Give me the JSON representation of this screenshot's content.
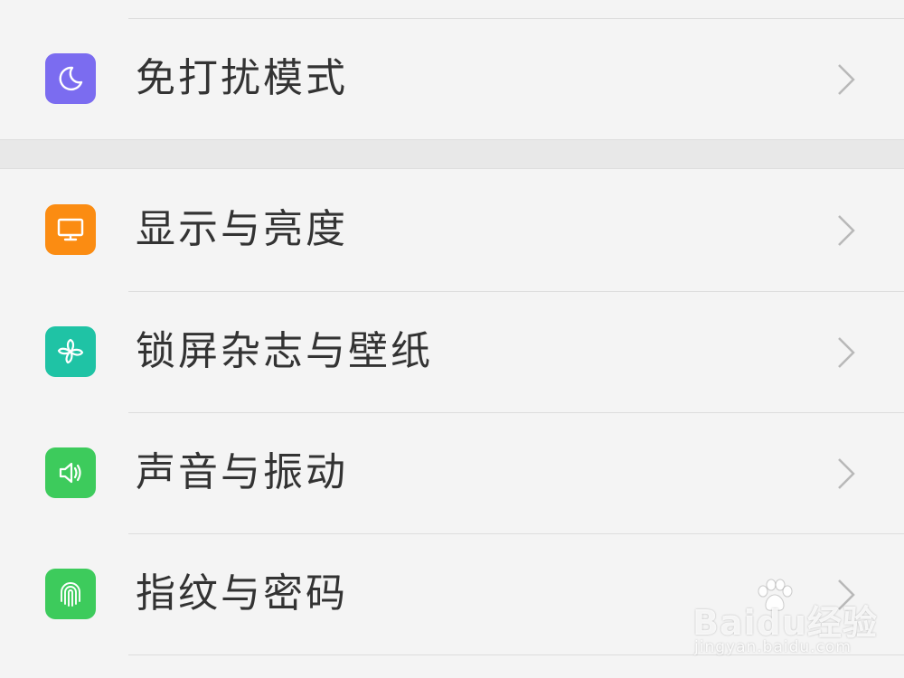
{
  "colors": {
    "background": "#f4f4f4",
    "section_gap": "#e8e8e8",
    "divider": "#dddddd",
    "label": "#333333",
    "chevron": "#b8b8b8"
  },
  "settings": {
    "items": [
      {
        "label": "免打扰模式",
        "icon": "moon-icon",
        "icon_color": "#7b6cf0"
      },
      {
        "label": "显示与亮度",
        "icon": "monitor-icon",
        "icon_color": "#fb8c12"
      },
      {
        "label": "锁屏杂志与壁纸",
        "icon": "pinwheel-icon",
        "icon_color": "#1fc3a5"
      },
      {
        "label": "声音与振动",
        "icon": "speaker-icon",
        "icon_color": "#3dcb5c"
      },
      {
        "label": "指纹与密码",
        "icon": "fingerprint-icon",
        "icon_color": "#3dcb5c"
      }
    ]
  },
  "watermark": {
    "brand": "Baidu经验",
    "url": "jingyan.baidu.com"
  }
}
